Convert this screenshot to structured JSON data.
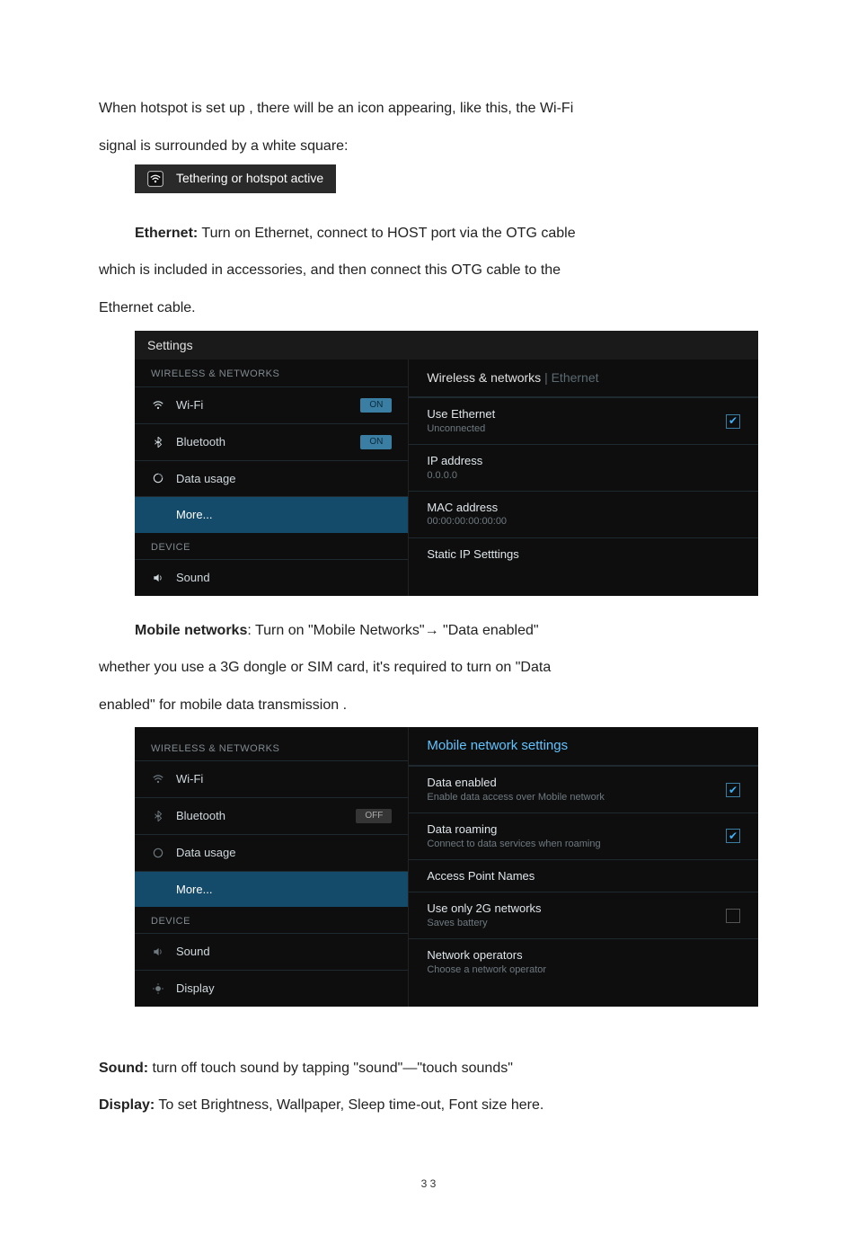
{
  "p1a": "When hotspot is set up , there will be an icon appearing, like this, the Wi-Fi",
  "p1b": "signal is surrounded by a white square:",
  "hotspot_label": "Tethering or hotspot active",
  "p2_lead": "Ethernet:",
  "p2a": " Turn on Ethernet, connect to HOST port via the OTG cable",
  "p2b": "which is included in accessories, and then connect this OTG cable to the",
  "p2c": "Ethernet cable.",
  "sc1": {
    "title": "Settings",
    "sect_wireless": "WIRELESS & NETWORKS",
    "items": [
      {
        "label": "Wi-Fi",
        "toggle": "ON"
      },
      {
        "label": "Bluetooth",
        "toggle": "ON"
      },
      {
        "label": "Data usage"
      },
      {
        "label": "More...",
        "selected": true
      }
    ],
    "sect_device": "DEVICE",
    "device_items": [
      {
        "label": "Sound"
      }
    ],
    "right_head": "Wireless & networks",
    "right_head_sub": "Ethernet",
    "rows": [
      {
        "t1": "Use Ethernet",
        "t2": "Unconnected",
        "chk": true
      },
      {
        "t1": "IP address",
        "t2": "0.0.0.0"
      },
      {
        "t1": "MAC address",
        "t2": "00:00:00:00:00:00"
      },
      {
        "t1": "Static IP Setttings"
      }
    ]
  },
  "p3_lead": "Mobile networks",
  "p3a": ": Turn on \"Mobile Networks\"→ \"Data enabled\"",
  "p3b": "whether you use a 3G dongle or SIM card, it's required to turn on  \"Data",
  "p3c": "enabled\" for mobile data transmission .",
  "sc2": {
    "sect_wireless": "WIRELESS & NETWORKS",
    "items": [
      {
        "label": "Wi-Fi"
      },
      {
        "label": "Bluetooth",
        "toggle": "OFF"
      },
      {
        "label": "Data usage"
      },
      {
        "label": "More...",
        "selected": true
      }
    ],
    "sect_device": "DEVICE",
    "device_items": [
      {
        "label": "Sound"
      },
      {
        "label": "Display"
      }
    ],
    "right_head": "Mobile network settings",
    "rows": [
      {
        "t1": "Data enabled",
        "t2": "Enable data access over Mobile network",
        "chk": true
      },
      {
        "t1": "Data roaming",
        "t2": "Connect to data services when roaming",
        "chk": true
      },
      {
        "t1": "Access Point Names"
      },
      {
        "t1": "Use only 2G networks",
        "t2": "Saves battery",
        "chk_empty": true
      },
      {
        "t1": "Network operators",
        "t2": "Choose a network operator"
      }
    ]
  },
  "p4_lead": "Sound:",
  "p4": " turn off touch sound by tapping \"sound\"—\"touch sounds\"",
  "p5_lead": "Display:",
  "p5": " To set Brightness, Wallpaper, Sleep time-out, Font size here.",
  "page_no": "3 3"
}
